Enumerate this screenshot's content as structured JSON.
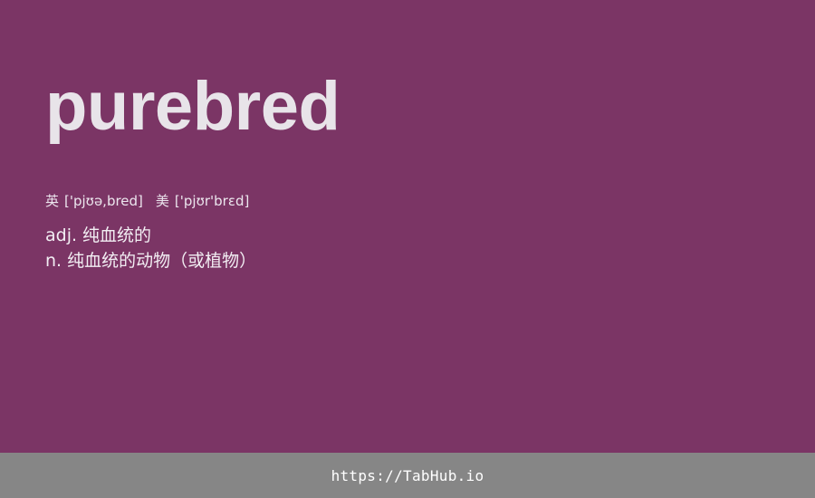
{
  "word": "purebred",
  "phonetics": [
    {
      "tag": "英",
      "ipa": "['pjʊə,bred]"
    },
    {
      "tag": "美",
      "ipa": "['pjʊr'brɛd]"
    }
  ],
  "definitions": [
    {
      "pos": "adj.",
      "meaning": "纯血统的"
    },
    {
      "pos": "n.",
      "meaning": "纯血统的动物（或植物）"
    }
  ],
  "footer": {
    "link": "https://TabHub.io"
  },
  "colors": {
    "background": "#7b3565",
    "footer_background": "#868686",
    "word_text": "#e8e4e9"
  }
}
